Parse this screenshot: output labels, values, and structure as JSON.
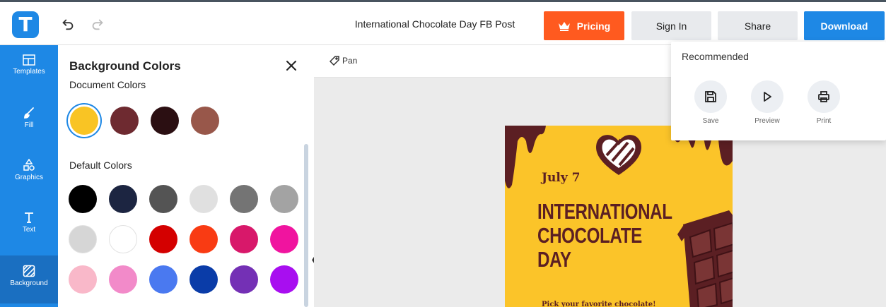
{
  "topbar": {
    "logo_letter": "T",
    "document_title": "International Chocolate Day FB Post",
    "pricing_label": "Pricing",
    "signin_label": "Sign In",
    "share_label": "Share",
    "download_label": "Download",
    "colors": {
      "brand": "#1e88e5",
      "pricing": "#ff5a1f"
    }
  },
  "rail": {
    "items": [
      {
        "label": "Templates",
        "icon": "templates-icon"
      },
      {
        "label": "Fill",
        "icon": "fill-brush-icon"
      },
      {
        "label": "Graphics",
        "icon": "graphics-icon"
      },
      {
        "label": "Text",
        "icon": "text-icon"
      },
      {
        "label": "Background",
        "icon": "background-icon",
        "active": true
      }
    ]
  },
  "panel": {
    "title": "Background Colors",
    "document_colors_label": "Document Colors",
    "default_colors_label": "Default Colors",
    "document_colors": [
      "#f9c424",
      "#6e2a30",
      "#2b0f12",
      "#98574a"
    ],
    "default_colors": [
      [
        "#000000",
        "#1c2541",
        "#545454",
        "#e0e0e0",
        "#747474",
        "#a3a3a3"
      ],
      [
        "#d6d6d6",
        "#ffffff",
        "#d40000",
        "#f93b13",
        "#d8186a",
        "#f0149f"
      ],
      [
        "#f9b8c9",
        "#f28ac9",
        "#4a79f0",
        "#0a3ca8",
        "#7430b5",
        "#a80ef0"
      ]
    ]
  },
  "canvas": {
    "pan_label": "Pan",
    "poster": {
      "date": "July 7",
      "headline_lines": [
        "INTERNATIONAL",
        "CHOCOLATE",
        "DAY"
      ],
      "subtext": "Pick your favorite chocolate!",
      "colors": {
        "background": "#fbc429",
        "chocolate": "#5b1f23"
      }
    }
  },
  "download_menu": {
    "title": "Recommended",
    "items": [
      {
        "label": "Save",
        "icon": "save-icon"
      },
      {
        "label": "Preview",
        "icon": "play-icon"
      },
      {
        "label": "Print",
        "icon": "print-icon"
      }
    ]
  }
}
